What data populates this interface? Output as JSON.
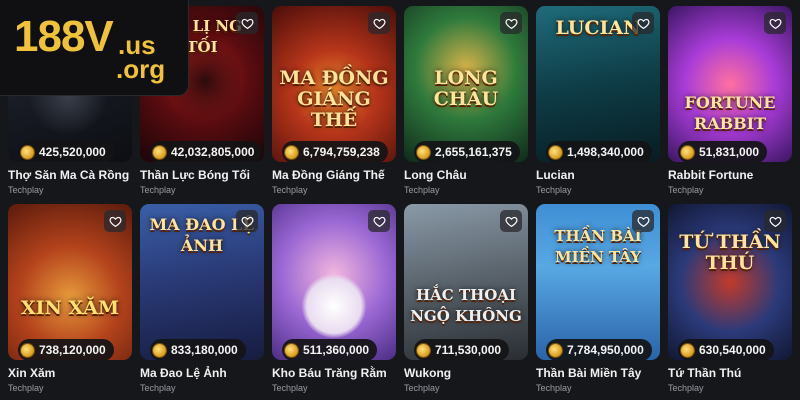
{
  "logo": {
    "main": "188V",
    "suffix1": ".us",
    "suffix2": ".org"
  },
  "games": [
    {
      "name": "Thợ Săn Ma Cà Rồng",
      "provider": "Techplay",
      "jackpot": "425,520,000",
      "art_text": ""
    },
    {
      "name": "Thần Lực Bóng Tối",
      "provider": "Techplay",
      "jackpot": "42,032,805,000",
      "art_text": "ẦN LỊ NG TỐI"
    },
    {
      "name": "Ma Đồng Giáng Thế",
      "provider": "Techplay",
      "jackpot": "6,794,759,238",
      "art_text": "MA ĐỒNG GIÁNG THẾ"
    },
    {
      "name": "Long Châu",
      "provider": "Techplay",
      "jackpot": "2,655,161,375",
      "art_text": "LONG CHÂU"
    },
    {
      "name": "Lucian",
      "provider": "Techplay",
      "jackpot": "1,498,340,000",
      "art_text": "LUCIAN"
    },
    {
      "name": "Rabbit Fortune",
      "provider": "Techplay",
      "jackpot": "51,831,000",
      "art_text": "FORTUNE RABBIT"
    },
    {
      "name": "Xin Xăm",
      "provider": "Techplay",
      "jackpot": "738,120,000",
      "art_text": "XIN XĂM"
    },
    {
      "name": "Ma Đao Lệ Ảnh",
      "provider": "Techplay",
      "jackpot": "833,180,000",
      "art_text": "MA ĐAO LỆ ẢNH"
    },
    {
      "name": "Kho Báu Trăng Rằm",
      "provider": "Techplay",
      "jackpot": "511,360,000",
      "art_text": ""
    },
    {
      "name": "Wukong",
      "provider": "Techplay",
      "jackpot": "711,530,000",
      "art_text": "HẮC THOẠI NGỘ KHÔNG"
    },
    {
      "name": "Thần Bài Miền Tây",
      "provider": "Techplay",
      "jackpot": "7,784,950,000",
      "art_text": "THẦN BÀI MIỀN TÂY"
    },
    {
      "name": "Tứ Thần Thú",
      "provider": "Techplay",
      "jackpot": "630,540,000",
      "art_text": "TỨ THẦN THÚ"
    }
  ],
  "icons": {
    "favorite": "heart-icon",
    "jackpot": "coin-icon"
  },
  "colors": {
    "background": "#16171b",
    "logo": "#f0c23a",
    "jackpot_bg": "#141416",
    "coin": "#e0a52a"
  }
}
